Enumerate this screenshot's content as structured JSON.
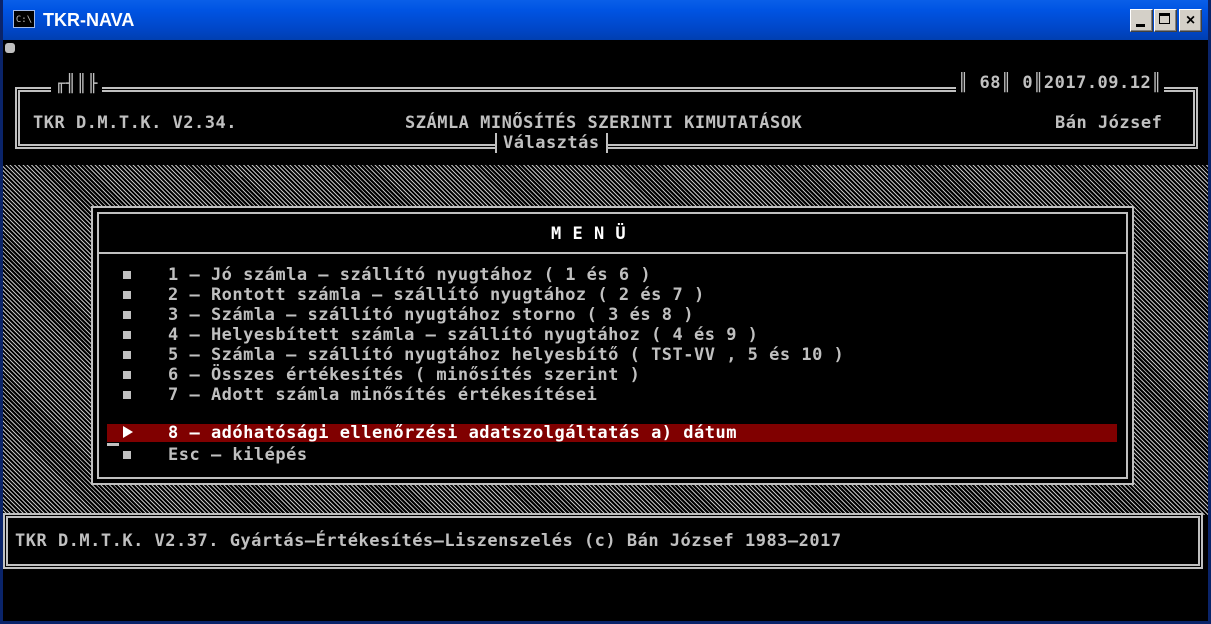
{
  "window": {
    "title": "TKR-NAVA",
    "icon_label": "C:\\",
    "buttons": [
      "minimize-icon",
      "maximize-icon",
      "close-icon"
    ],
    "close_glyph": "×"
  },
  "header": {
    "topline_pre": "╓╢║╟",
    "topline_right": "║ 68║ 0║2017.09.12║",
    "app_version": "TKR D.M.T.K. V2.34.",
    "report_title": "SZÁMLA MINŐSÍTÉS SZERINTI KIMUTATÁSOK",
    "user_name": "Bán József",
    "section_label": "Választás"
  },
  "menu": {
    "title": "M E N Ü",
    "items": [
      {
        "key": "1",
        "label": "1 – Jó számla – szállító nyugtához ( 1 és 6 )"
      },
      {
        "key": "2",
        "label": "2 – Rontott számla – szállító nyugtához ( 2 és 7 )"
      },
      {
        "key": "3",
        "label": "3 – Számla – szállító nyugtához storno ( 3 és 8 )"
      },
      {
        "key": "4",
        "label": "4 – Helyesbített számla – szállító nyugtához ( 4 és 9 )"
      },
      {
        "key": "5",
        "label": "5 – Számla – szállító nyugtához helyesbítő ( TST-VV , 5 és 10 )"
      },
      {
        "key": "6",
        "label": "6 – Összes értékesítés ( minősítés szerint )"
      },
      {
        "key": "7",
        "label": "7 – Adott számla minősítés értékesítései"
      },
      {
        "key": "8",
        "label": "8 – adóhatósági ellenőrzési adatszolgáltatás a) dátum"
      },
      {
        "key": "Esc",
        "label": "Esc – kilépés"
      }
    ],
    "selected_index": 7
  },
  "footer": {
    "text": "TKR D.M.T.K. V2.37. Gyártás–Értékesítés–Liszenszelés (c) Bán József 1983–2017"
  },
  "colors": {
    "console_bg": "#000000",
    "console_fg": "#c0c0c0",
    "selection_bg": "#800000",
    "titlebar": "#0054e3"
  }
}
